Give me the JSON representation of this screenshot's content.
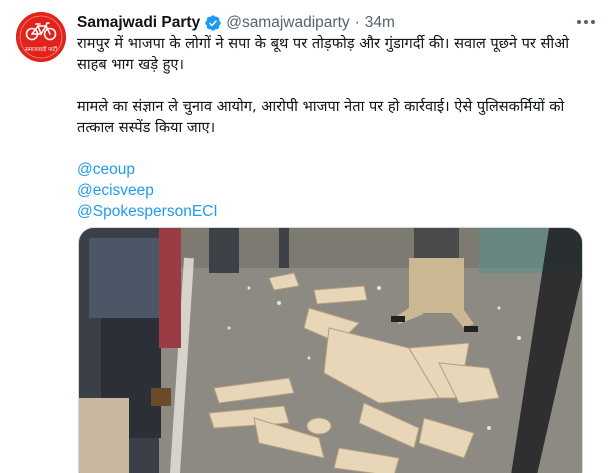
{
  "tweet": {
    "display_name": "Samajwadi Party",
    "handle": "@samajwadiparty",
    "separator": "·",
    "time": "34m",
    "paragraphs": [
      "रामपुर में भाजपा के लोगों ने सपा के बूथ पर तोड़फोड़ और गुंडागर्दी की। सवाल पूछने पर सीओ साहब भाग खड़े हुए।",
      "मामले का संज्ञान ले चुनाव आयोग, आरोपी भाजपा नेता पर हो कार्रवाई। ऐसे पुलिसकर्मियों को तत्काल सस्पेंड किया जाए।"
    ],
    "mentions": [
      "@ceoup",
      "@ecisveep",
      "@SpokespersonECI"
    ]
  },
  "avatar": {
    "logo_text": "समाजवादी पार्टी"
  },
  "icons": {
    "verified": "verified-badge-icon",
    "more": "more-options-icon",
    "avatar": "bicycle-logo-icon"
  },
  "colors": {
    "link": "#1d9bf0",
    "verified": "#1d9bf0",
    "avatar_bg": "#e2231a",
    "secondary_text": "#536471"
  }
}
